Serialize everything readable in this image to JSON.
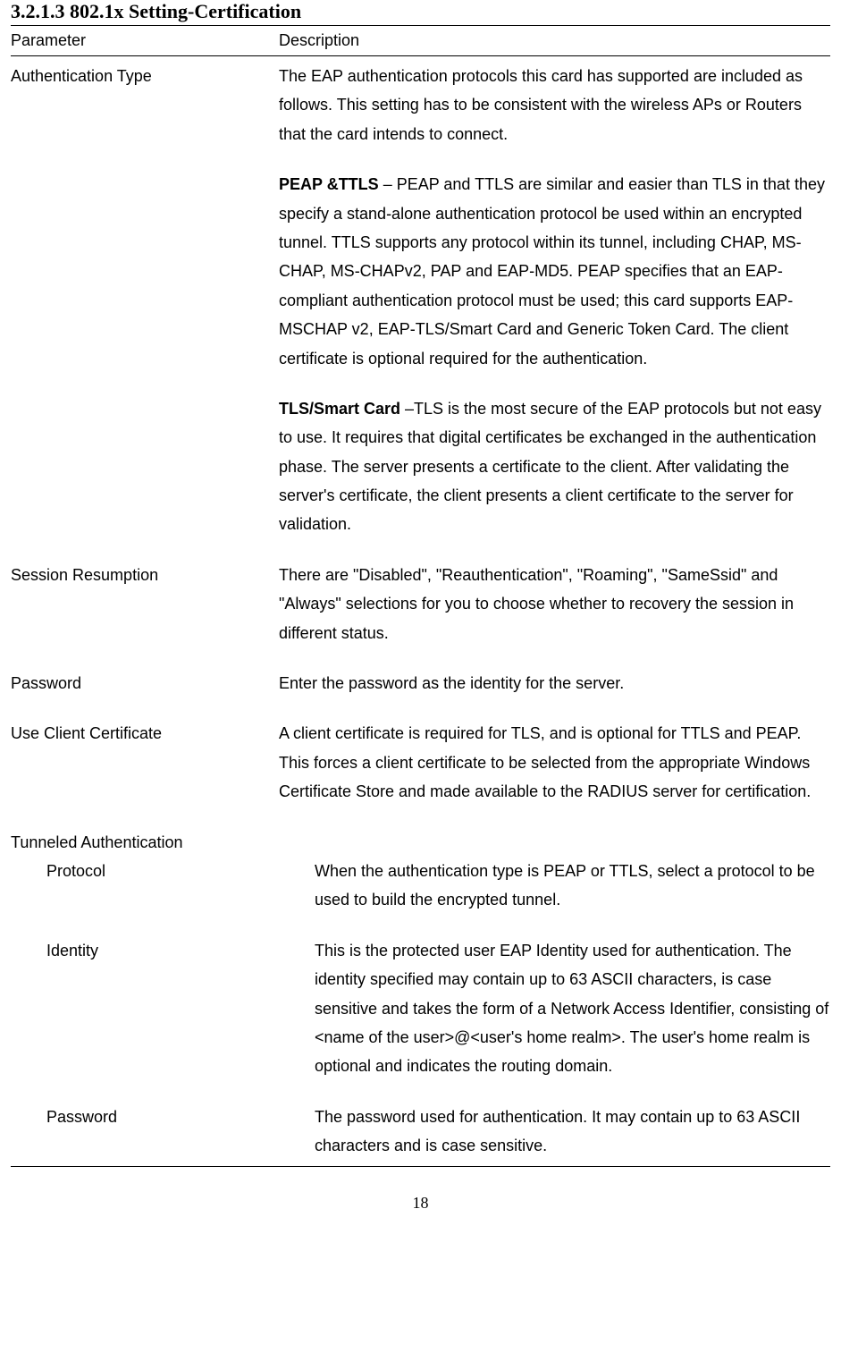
{
  "heading": "3.2.1.3    802.1x Setting-Certification",
  "header": {
    "parameter": "Parameter",
    "description": "Description"
  },
  "rows": {
    "auth_type": {
      "label": "Authentication Type",
      "intro": "The EAP authentication protocols this card has supported are included as follows. This setting has to be consistent with the wireless APs or Routers that the card intends to connect.",
      "peap_label": "PEAP &TTLS",
      "peap_text": " – PEAP and TTLS are similar and easier than TLS in that they specify a stand-alone authentication protocol be used within an encrypted tunnel. TTLS supports any protocol within its tunnel, including CHAP, MS-CHAP, MS-CHAPv2, PAP and EAP-MD5. PEAP specifies that an EAP-compliant authentication protocol must be used; this card supports EAP-MSCHAP v2, EAP-TLS/Smart Card and Generic Token Card. The client certificate is optional required for the authentication.",
      "tls_label": "TLS/Smart Card",
      "tls_text": " –TLS is the most secure of the EAP protocols but not easy to use. It requires that digital certificates be exchanged in the authentication phase. The server presents a certificate to the client. After validating the server's certificate, the client presents a client certificate to the server for validation."
    },
    "session_resumption": {
      "label": "Session Resumption",
      "text": "There are \"Disabled\", \"Reauthentication\", \"Roaming\", \"SameSsid\" and \"Always\" selections for you to choose whether to recovery the session in different status."
    },
    "password": {
      "label": "Password",
      "text": "Enter the password as the identity for the server."
    },
    "use_client_cert": {
      "label": "Use Client Certificate",
      "text": "A client certificate is required for TLS, and is optional for TTLS and PEAP. This forces a client certificate to be selected from the appropriate Windows Certificate Store and made available to the RADIUS server for certification."
    },
    "tunneled_auth": {
      "label": "Tunneled Authentication",
      "protocol": {
        "label": "Protocol",
        "text": "When the authentication type is PEAP or TTLS, select a protocol to be used to build the encrypted tunnel."
      },
      "identity": {
        "label": "Identity",
        "text": "This is the protected user EAP Identity used for authentication. The identity specified may contain up to 63 ASCII characters, is case sensitive and takes the form of a Network Access Identifier, consisting of <name of the user>@<user's home realm>. The user's home realm is optional and indicates the routing domain."
      },
      "password": {
        "label": "Password",
        "text": "The password used for authentication. It may contain up to 63 ASCII characters and is case sensitive."
      }
    }
  },
  "page_number": "18"
}
